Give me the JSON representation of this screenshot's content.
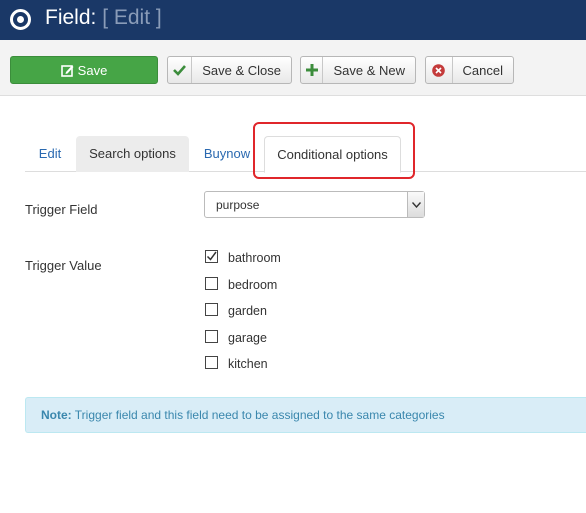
{
  "header": {
    "title": "Field:",
    "subtitle": "[ Edit ]",
    "icon": "record-icon"
  },
  "toolbar": {
    "save_label": "Save",
    "save_close_label": "Save & Close",
    "save_new_label": "Save & New",
    "cancel_label": "Cancel"
  },
  "tabs": [
    {
      "label": "Edit"
    },
    {
      "label": "Search options"
    },
    {
      "label": "Buynow"
    },
    {
      "label": "Conditional options",
      "active": true
    }
  ],
  "form": {
    "trigger_field_label": "Trigger Field",
    "trigger_field_value": "purpose",
    "trigger_value_label": "Trigger Value",
    "options": [
      {
        "label": "bathroom",
        "checked": true
      },
      {
        "label": "bedroom",
        "checked": false
      },
      {
        "label": "garden",
        "checked": false
      },
      {
        "label": "garage",
        "checked": false
      },
      {
        "label": "kitchen",
        "checked": false
      }
    ]
  },
  "note": {
    "prefix": "Note:",
    "text": "Trigger field and this field need to be assigned to the same categories"
  },
  "colors": {
    "header_bg": "#1a3867",
    "save_green": "#46a546",
    "highlight_red": "#e0262b",
    "link_blue": "#2a69b0",
    "note_bg": "#d9edf7"
  }
}
